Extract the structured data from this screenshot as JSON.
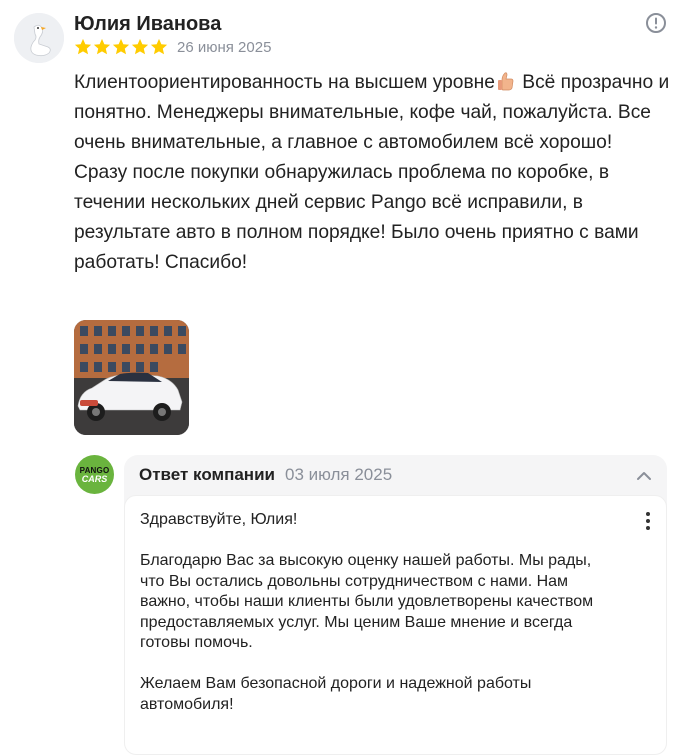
{
  "review": {
    "author": "Юлия Иванова",
    "avatar_icon": "goose-avatar-icon",
    "rating": 5,
    "date": "26 июня 2025",
    "report_icon": "exclamation-circle-icon",
    "text_p1_a": "Клиентоориентированность на высшем уровне",
    "text_p1_emoji": "thumbs-up-icon",
    "text_p1_b": " Всё прозрачно и понятно. Менеджеры внимательные, кофе чай, пожалуйста. Все очень внимательные, а главное с автомобилем всё хорошо!",
    "text_p2": "Сразу после покупки обнаружилась проблема по коробке, в течении нескольких дней сервис Pango всё исправили, в результате авто в полном порядке! Было очень приятно с вами работать! Спасибо!",
    "photo": "white-crossover-car-photo"
  },
  "reply": {
    "logo_line1": "PANGO",
    "logo_line2": "CARS",
    "title": "Ответ компании",
    "date": "03 июля 2025",
    "chevron_icon": "chevron-up-icon",
    "menu_icon": "kebab-menu-icon",
    "greeting": "Здравствуйте, Юлия!",
    "paragraph1": "Благодарю Вас за высокую оценку нашей работы. Мы рады, что Вы остались довольны сотрудничеством с нами. Нам важно, чтобы наши клиенты были удовлетворены качеством предоставляемых услуг. Мы ценим Ваше мнение и всегда готовы помочь.",
    "paragraph2": "Желаем Вам безопасной дороги и надежной работы автомобиля!"
  },
  "colors": {
    "star": "#fc0",
    "muted": "#8a8f99",
    "logo_green": "#6ab43e",
    "reply_bg": "#f5f5f6"
  }
}
